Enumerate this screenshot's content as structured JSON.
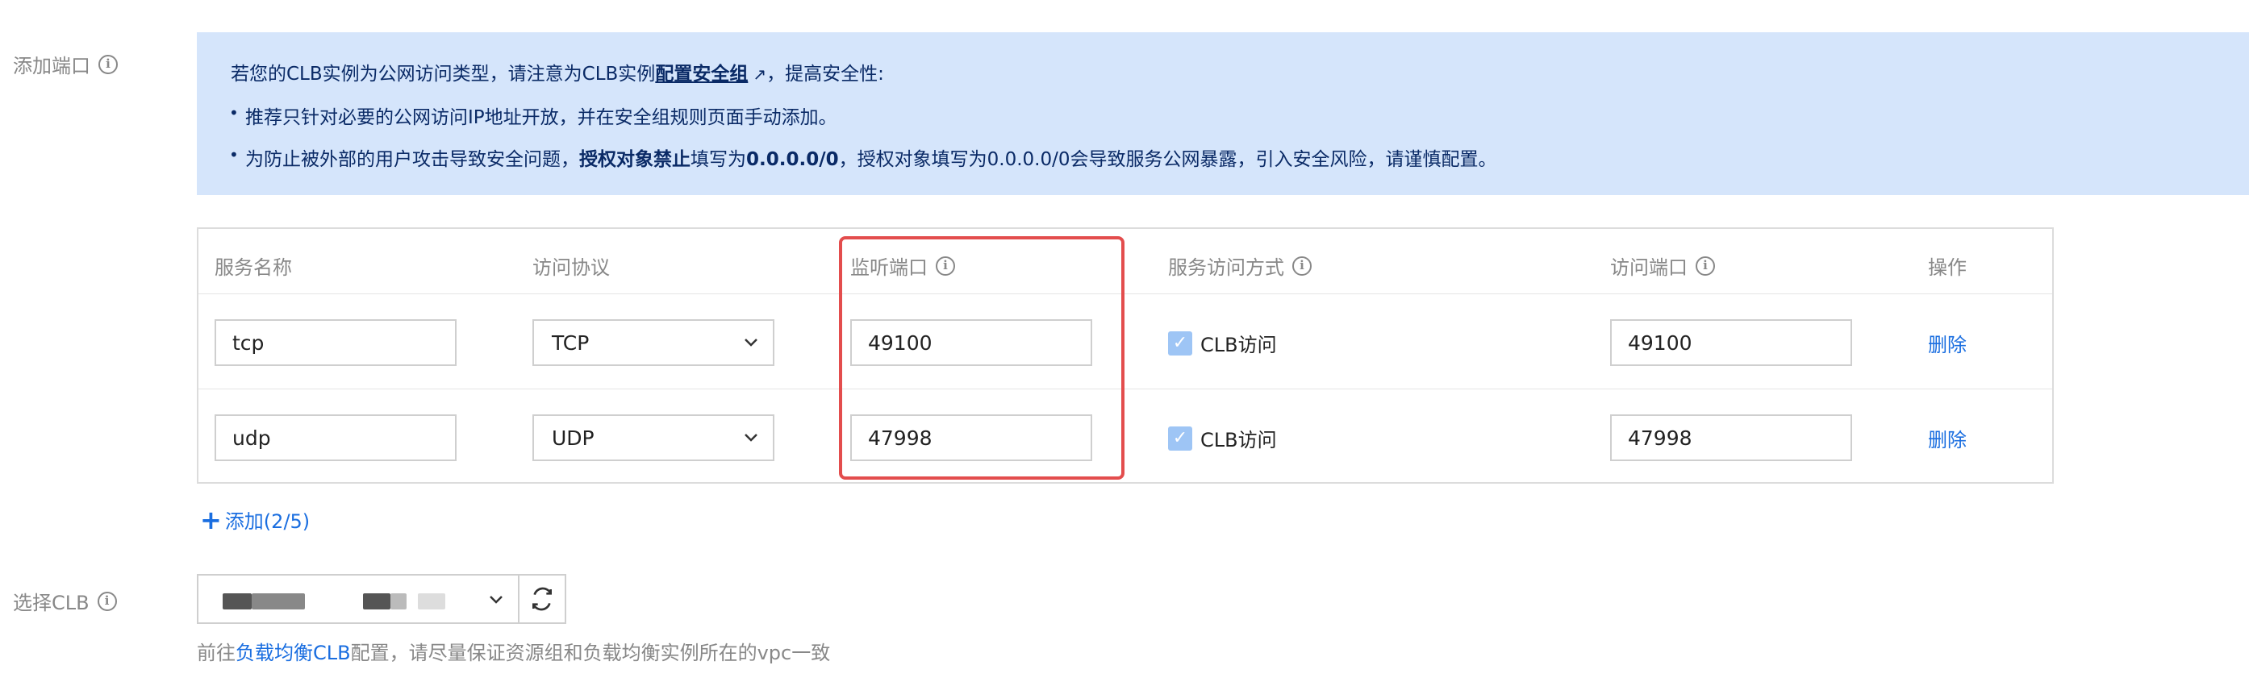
{
  "add_port_label": "添加端口",
  "notice": {
    "line1_prefix": "若您的CLB实例为公网访问类型，请注意为CLB实例",
    "line1_link": "配置安全组",
    "line1_suffix": "，提高安全性:",
    "bullet1": "推荐只针对必要的公网访问IP地址开放，并在安全组规则页面手动添加。",
    "bullet2_prefix": "为防止被外部的用户攻击导致安全问题，",
    "bullet2_bold1": "授权对象禁止",
    "bullet2_mid": "填写为",
    "bullet2_bold2": "0.0.0.0/0",
    "bullet2_suffix": "，授权对象填写为0.0.0.0/0会导致服务公网暴露，引入安全风险，请谨慎配置。"
  },
  "table": {
    "headers": {
      "service_name": "服务名称",
      "protocol": "访问协议",
      "listen_port": "监听端口",
      "access_method": "服务访问方式",
      "access_port": "访问端口",
      "actions": "操作"
    },
    "rows": [
      {
        "service_name": "tcp",
        "protocol": "TCP",
        "listen_port": "49100",
        "access_method": "CLB访问",
        "access_port": "49100",
        "action": "删除"
      },
      {
        "service_name": "udp",
        "protocol": "UDP",
        "listen_port": "47998",
        "access_method": "CLB访问",
        "access_port": "47998",
        "action": "删除"
      }
    ]
  },
  "add_button": "添加(2/5)",
  "select_clb_label": "选择CLB",
  "hint": {
    "prefix": "前往",
    "link": "负载均衡CLB",
    "suffix": "配置，请尽量保证资源组和负载均衡实例所在的vpc一致"
  },
  "colors": {
    "notice_bg": "#d5e5fb",
    "link": "#1a6ee0",
    "highlight": "#e34d4d",
    "checkbox": "#9ec5f5"
  }
}
